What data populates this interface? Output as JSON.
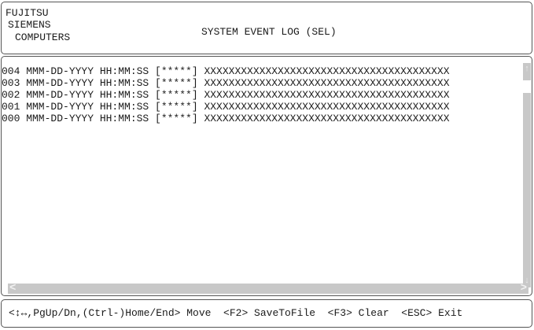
{
  "header": {
    "vendor_lines": [
      "FUJITSU",
      "SIEMENS",
      "COMPUTERS"
    ],
    "title": "SYSTEM EVENT LOG (SEL)"
  },
  "log": {
    "entries": [
      "004 MMM-DD-YYYY HH:MM:SS [*****] XXXXXXXXXXXXXXXXXXXXXXXXXXXXXXXXXXXXXXXX",
      "003 MMM-DD-YYYY HH:MM:SS [*****] XXXXXXXXXXXXXXXXXXXXXXXXXXXXXXXXXXXXXXXX",
      "002 MMM-DD-YYYY HH:MM:SS [*****] XXXXXXXXXXXXXXXXXXXXXXXXXXXXXXXXXXXXXXXX",
      "001 MMM-DD-YYYY HH:MM:SS [*****] XXXXXXXXXXXXXXXXXXXXXXXXXXXXXXXXXXXXXXXX",
      "000 MMM-DD-YYYY HH:MM:SS [*****] XXXXXXXXXXXXXXXXXXXXXXXXXXXXXXXXXXXXXXXX"
    ]
  },
  "scrollbars": {
    "up_arrow": "↑",
    "down_arrow": "↓",
    "left_arrow": "<",
    "right_arrow": ">"
  },
  "footer": {
    "help_text": "<↕↔,PgUp/Dn,(Ctrl-)Home/End> Move  <F2> SaveToFile  <F3> Clear  <ESC> Exit"
  },
  "colors": {
    "scrollbar_track": "#c8c8c8",
    "border": "#555555",
    "text": "#1a1a1a"
  }
}
